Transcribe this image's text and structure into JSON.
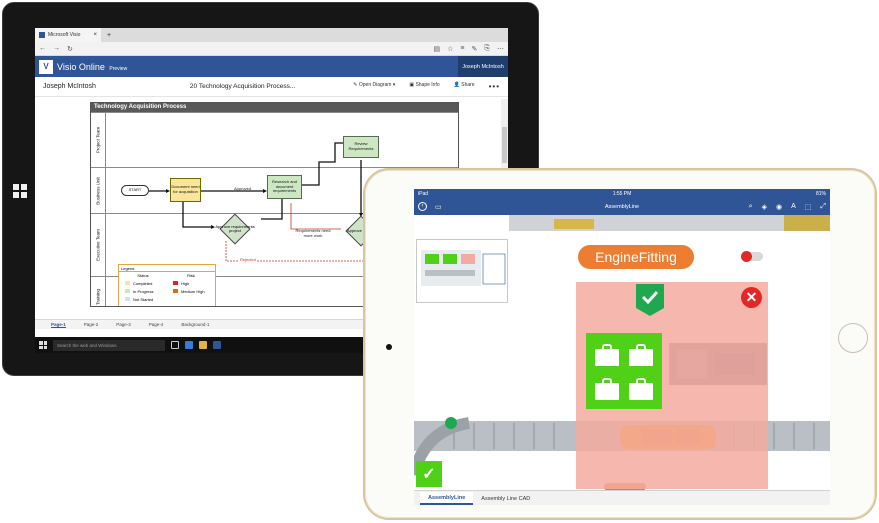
{
  "surface": {
    "browser_tab_title": "Microsoft Visio",
    "app_name": "Visio Online",
    "app_badge": "Preview",
    "header_user": "Joseph McIntosh",
    "doc_owner": "Joseph McIntosh",
    "doc_name": "20 Technology Acquisition Process...",
    "actions": {
      "open_diagram": "Open Diagram",
      "shape_info": "Shape Info",
      "share": "Share"
    },
    "diagram": {
      "title": "Technology Acquisition Process",
      "lanes": [
        "Project Team",
        "Business Unit",
        "Executive Team",
        "Training"
      ],
      "shapes": {
        "review": "Review Requirements",
        "start": "START",
        "document_need": "Document need for acquisition",
        "research": "Research and document requirements",
        "approve_requirements": "Approve requirements project",
        "approve_project": "Approve project"
      },
      "flow_labels": {
        "approved": "Approved",
        "requirements_more_work": "Requirements need more work",
        "rejected": "Rejected"
      },
      "legend": {
        "title": "Legend",
        "status_header": "Status",
        "risk_header": "Risk",
        "status_items": [
          "Completed",
          "In Progress",
          "Not Started"
        ],
        "status_colors": [
          "#fbe59a",
          "#cde7c3",
          "#cde2f3"
        ],
        "risk_items": [
          "High",
          "Medium High",
          ""
        ],
        "risk_colors": [
          "#d9262b",
          "#e36c09"
        ]
      }
    },
    "page_tabs": [
      "Page-1",
      "Page-2",
      "Page-3",
      "Page-4",
      "Background-1"
    ],
    "taskbar_search": "Search the web and Windows"
  },
  "ipad": {
    "status_carrier": "iPad",
    "status_time": "1:55 PM",
    "status_battery": "81%",
    "doc_title": "AssemblyLine",
    "engine_label": "EngineFitting",
    "tabs": [
      "AssemblyLine",
      "Assembly Line CAD"
    ],
    "colors": {
      "accent_blue": "#2f5597",
      "orange": "#ed7d31",
      "green": "#50d017",
      "red": "#e32626"
    }
  }
}
